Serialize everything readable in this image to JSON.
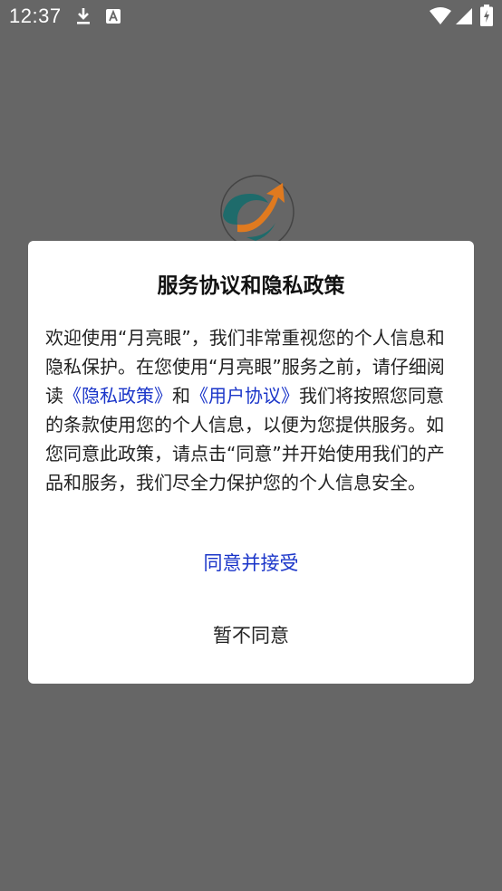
{
  "status_bar": {
    "time": "12:37",
    "icons": [
      "download-icon",
      "font-a-icon",
      "wifi-icon",
      "cellular-signal-icon",
      "battery-charging-icon"
    ]
  },
  "dialog": {
    "title": "服务协议和隐私政策",
    "body": {
      "part1": "欢迎使用“月亮眼”，我们非常重视您的个人信息和隐私保护。在您使用“月亮眼”服务之前，请仔细阅读",
      "privacy_link": "《隐私政策》",
      "and": "和",
      "user_agreement_link": "《用户协议》",
      "part2": "我们将按照您同意的条款使用您的个人信息，以便为您提供服务。如您同意此政策，请点击“同意”并开始使用我们的产品和服务，我们尽全力保护您的个人信息安全。"
    },
    "accept_label": "同意并接受",
    "decline_label": "暂不同意"
  },
  "colors": {
    "overlay": "#666666",
    "link": "#1a35c9",
    "logo_teal": "#1e6b6b",
    "logo_orange": "#e07a1f"
  }
}
